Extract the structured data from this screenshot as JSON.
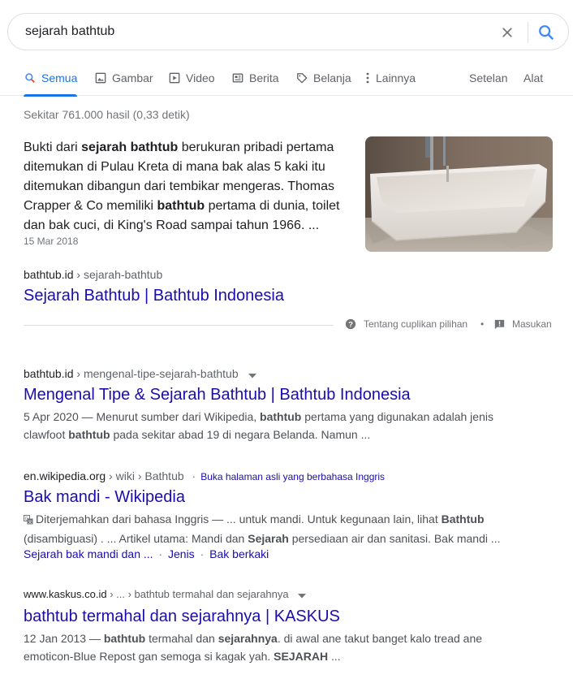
{
  "search": {
    "query": "sejarah bathtub"
  },
  "tabs": [
    {
      "label": "Semua",
      "icon": "search-icon",
      "active": true
    },
    {
      "label": "Gambar",
      "icon": "image-icon"
    },
    {
      "label": "Video",
      "icon": "video-icon"
    },
    {
      "label": "Berita",
      "icon": "news-icon"
    },
    {
      "label": "Belanja",
      "icon": "tag-icon"
    },
    {
      "label": "Lainnya",
      "icon": "more-vert-icon"
    }
  ],
  "tools": {
    "settings": "Setelan",
    "tools": "Alat"
  },
  "stats": "Sekitar 761.000 hasil (0,33 detik)",
  "featured": {
    "parts": [
      {
        "t": "Bukti dari ",
        "b": false
      },
      {
        "t": "sejarah bathtub",
        "b": true
      },
      {
        "t": " berukuran pribadi pertama ditemukan di Pulau Kreta di mana bak alas 5 kaki itu ditemukan dibangun dari tembikar mengeras. Thomas Crapper & Co memiliki ",
        "b": false
      },
      {
        "t": "bathtub",
        "b": true
      },
      {
        "t": " pertama di dunia, toilet dan bak cuci, di King's Road sampai tahun 1966. ...",
        "b": false
      }
    ],
    "date": "15 Mar 2018",
    "cite_domain": "bathtub.id",
    "cite_path": " › sejarah-bathtub",
    "title": "Sejarah Bathtub | Bathtub Indonesia",
    "about": "Tentang cuplikan pilihan",
    "dot": "•",
    "feedback": "Masukan"
  },
  "results": [
    {
      "cite_domain": "bathtub.id",
      "cite_path": " › mengenal-tipe-sejarah-bathtub",
      "title": "Mengenal Tipe & Sejarah Bathtub | Bathtub Indonesia",
      "desc1": [
        {
          "t": "5 Apr 2020 — Menurut sumber dari Wikipedia, ",
          "b": false
        },
        {
          "t": "bathtub",
          "b": true
        },
        {
          "t": " pertama yang digunakan adalah jenis",
          "b": false
        }
      ],
      "desc2": [
        {
          "t": "clawfoot ",
          "b": false
        },
        {
          "t": "bathtub",
          "b": true
        },
        {
          "t": " pada sekitar abad 19 di negara Belanda. Namun ...",
          "b": false
        }
      ]
    },
    {
      "cite_domain": "en.wikipedia.org",
      "cite_path": " › wiki › Bathtub",
      "translate_link": "Buka halaman asli yang berbahasa Inggris",
      "title": "Bak mandi - Wikipedia",
      "desc1": [
        {
          "t": "Diterjemahkan dari bahasa Inggris — ... untuk mandi. Untuk kegunaan lain, lihat ",
          "b": false
        },
        {
          "t": "Bathtub",
          "b": true
        }
      ],
      "desc2": [
        {
          "t": "(disambiguasi) . ... Artikel utama: Mandi dan ",
          "b": false
        },
        {
          "t": "Sejarah",
          "b": true
        },
        {
          "t": " persediaan air dan sanitasi. Bak mandi ...",
          "b": false
        }
      ],
      "sitelinks": [
        "Sejarah bak mandi dan ...",
        "Jenis",
        "Bak berkaki"
      ]
    },
    {
      "cite_domain": "www.kaskus.co.id",
      "cite_path": " › ... › bathtub termahal dan sejarahnya",
      "title": "bathtub termahal dan sejarahnya | KASKUS",
      "desc1": [
        {
          "t": "12 Jan 2013 — ",
          "b": false
        },
        {
          "t": "bathtub",
          "b": true
        },
        {
          "t": " termahal dan ",
          "b": false
        },
        {
          "t": "sejarahnya",
          "b": true
        },
        {
          "t": ". di awal ane takut banget kalo tread ane",
          "b": false
        }
      ],
      "desc2": [
        {
          "t": "emoticon-Blue Repost gan semoga si kagak yah. ",
          "b": false
        },
        {
          "t": "SEJARAH",
          "b": true
        },
        {
          "t": " ...",
          "b": false
        }
      ]
    }
  ],
  "colors": {
    "link": "#1a0dab",
    "accent": "#1a73e8",
    "meta": "#70757a",
    "desc": "#4d5156"
  }
}
